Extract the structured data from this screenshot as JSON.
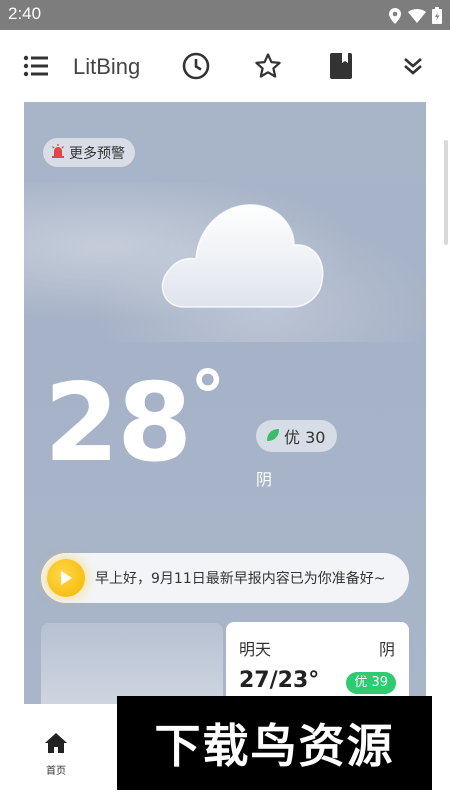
{
  "status_bar": {
    "time": "2:40",
    "icons": [
      "location-icon",
      "wifi-icon",
      "battery-icon"
    ]
  },
  "toolbar": {
    "title": "LitBing",
    "icons": [
      "menu-icon",
      "history-clock-icon",
      "star-icon",
      "bookmark-icon",
      "chevron-double-down-icon"
    ]
  },
  "weather": {
    "alert_label": "更多预警",
    "temperature": "28",
    "degree": "°",
    "aqi_label": "优 30",
    "condition": "阴",
    "news": "早上好，9月11日最新早报内容已为你准备好~"
  },
  "forecast": {
    "day": "明天",
    "condition": "阴",
    "temp_range": "27/23°",
    "aqi": "优 39"
  },
  "bottom_nav": {
    "home_label": "首页"
  },
  "watermark": {
    "text": "下载鸟资源"
  },
  "colors": {
    "sky": "#a8b4c8",
    "aqi_green": "#2dcc70",
    "play_yellow": "#f5b400",
    "alert_red": "#e8424a"
  }
}
